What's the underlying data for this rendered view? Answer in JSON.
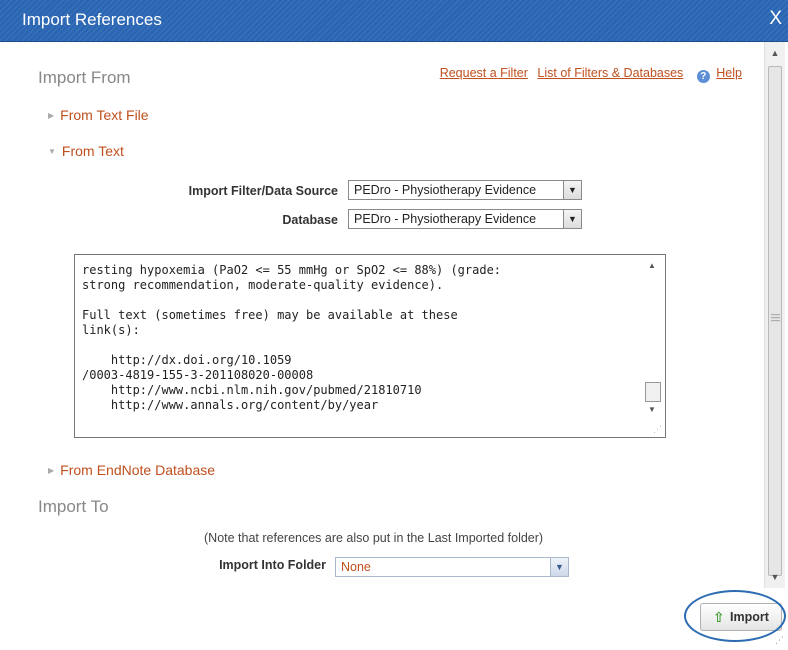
{
  "window": {
    "title": "Import References",
    "close_label": "X"
  },
  "import_from": {
    "heading": "Import From",
    "links": {
      "request_filter": "Request a Filter",
      "list_filters": "List of Filters & Databases",
      "help": "Help"
    },
    "sections": {
      "text_file": "From Text File",
      "text": "From Text",
      "endnote": "From EndNote Database"
    },
    "filter_label": "Import Filter/Data Source",
    "filter_value": "PEDro - Physiotherapy Evidence",
    "database_label": "Database",
    "database_value": "PEDro - Physiotherapy Evidence",
    "text_content": "resting hypoxemia (PaO2 <= 55 mmHg or SpO2 <= 88%) (grade:\nstrong recommendation, moderate-quality evidence).\n\nFull text (sometimes free) may be available at these\nlink(s):\n\n    http://dx.doi.org/10.1059\n/0003-4819-155-3-201108020-00008\n    http://www.ncbi.nlm.nih.gov/pubmed/21810710\n    http://www.annals.org/content/by/year"
  },
  "import_to": {
    "heading": "Import To",
    "note": "(Note that references are also put in the Last Imported folder)",
    "folder_label": "Import Into Folder",
    "folder_value": "None"
  },
  "buttons": {
    "import": "Import"
  },
  "colors": {
    "title_bar": "#2a66b3",
    "link": "#c0501e",
    "import_arrow": "#3f9a2e",
    "highlight": "#2b6cb3"
  }
}
